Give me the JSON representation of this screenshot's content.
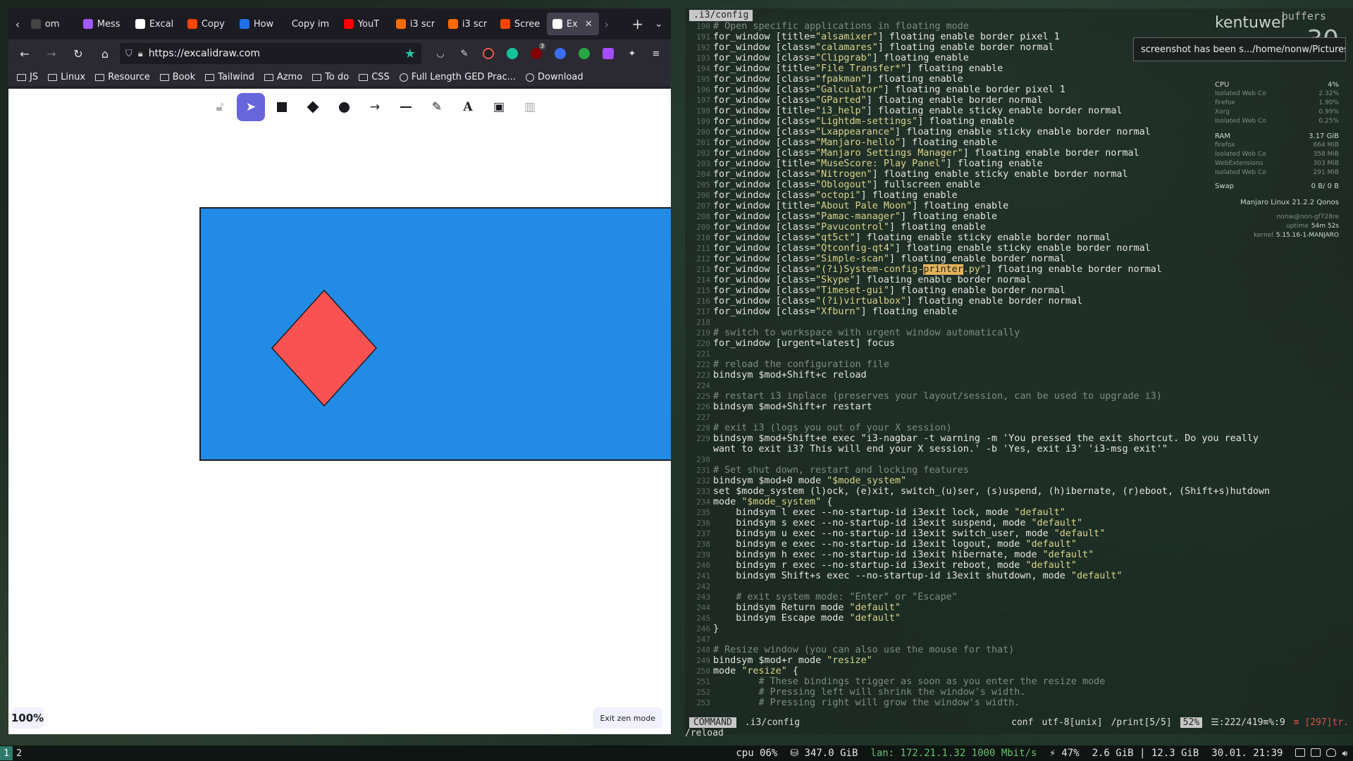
{
  "browser": {
    "tabs": [
      {
        "label": "om",
        "color": "#444"
      },
      {
        "label": "Mess",
        "color": "#a259ff"
      },
      {
        "label": "Excal",
        "color": "#ffffff"
      },
      {
        "label": "Copy",
        "color": "#ff4500"
      },
      {
        "label": "How",
        "color": "#1f6feb"
      },
      {
        "label": "Copy im",
        "color": ""
      },
      {
        "label": "YouT",
        "color": "#ff0000"
      },
      {
        "label": "i3 scr",
        "color": "#ff6a00"
      },
      {
        "label": "i3 scr",
        "color": "#ff6a00"
      },
      {
        "label": "Scree",
        "color": "#ff4500"
      },
      {
        "label": "Ex",
        "color": "#ffffff"
      }
    ],
    "url": "https://excalidraw.com",
    "bookmarks": [
      {
        "label": "JS",
        "icon": "folder"
      },
      {
        "label": "Linux",
        "icon": "folder"
      },
      {
        "label": "Resource",
        "icon": "folder"
      },
      {
        "label": "Book",
        "icon": "folder"
      },
      {
        "label": "Tailwind",
        "icon": "folder"
      },
      {
        "label": "Azmo",
        "icon": "folder"
      },
      {
        "label": "To do",
        "icon": "folder"
      },
      {
        "label": "CSS",
        "icon": "folder"
      },
      {
        "label": "Full Length GED Prac...",
        "icon": "globe"
      },
      {
        "label": "Download",
        "icon": "globe"
      }
    ],
    "extension_badge": "3"
  },
  "excalidraw": {
    "zoom": "100%",
    "exit_zen": "Exit zen mode",
    "colors": {
      "rect_fill": "#228be6",
      "diamond_fill": "#fa5252",
      "accent": "#6965db"
    }
  },
  "vim": {
    "title": ".i3/config",
    "buffers": "buffers",
    "lines": [
      {
        "n": "190",
        "t": "# Open specific applications in floating mode",
        "k": "com"
      },
      {
        "n": "191",
        "t": "for_window [title=\"alsamixer\"] floating enable border pixel 1"
      },
      {
        "n": "192",
        "t": "for_window [class=\"calamares\"] floating enable border normal"
      },
      {
        "n": "193",
        "t": "for_window [class=\"Clipgrab\"] floating enable"
      },
      {
        "n": "194",
        "t": "for_window [title=\"File Transfer*\"] floating enable"
      },
      {
        "n": "195",
        "t": "for_window [class=\"fpakman\"] floating enable"
      },
      {
        "n": "196",
        "t": "for_window [class=\"Galculator\"] floating enable border pixel 1"
      },
      {
        "n": "197",
        "t": "for_window [class=\"GParted\"] floating enable border normal"
      },
      {
        "n": "198",
        "t": "for_window [title=\"i3_help\"] floating enable sticky enable border normal"
      },
      {
        "n": "199",
        "t": "for_window [class=\"Lightdm-settings\"] floating enable"
      },
      {
        "n": "200",
        "t": "for_window [class=\"Lxappearance\"] floating enable sticky enable border normal"
      },
      {
        "n": "201",
        "t": "for_window [class=\"Manjaro-hello\"] floating enable"
      },
      {
        "n": "202",
        "t": "for_window [class=\"Manjaro Settings Manager\"] floating enable border normal"
      },
      {
        "n": "203",
        "t": "for_window [title=\"MuseScore: Play Panel\"] floating enable"
      },
      {
        "n": "204",
        "t": "for_window [class=\"Nitrogen\"] floating enable sticky enable border normal"
      },
      {
        "n": "205",
        "t": "for_window [class=\"Oblogout\"] fullscreen enable"
      },
      {
        "n": "206",
        "t": "for_window [class=\"octopi\"] floating enable"
      },
      {
        "n": "207",
        "t": "for_window [title=\"About Pale Moon\"] floating enable"
      },
      {
        "n": "208",
        "t": "for_window [class=\"Pamac-manager\"] floating enable"
      },
      {
        "n": "209",
        "t": "for_window [class=\"Pavucontrol\"] floating enable"
      },
      {
        "n": "210",
        "t": "for_window [class=\"qt5ct\"] floating enable sticky enable border normal"
      },
      {
        "n": "211",
        "t": "for_window [class=\"Qtconfig-qt4\"] floating enable sticky enable border normal"
      },
      {
        "n": "212",
        "t": "for_window [class=\"Simple-scan\"] floating enable border normal"
      },
      {
        "n": "213",
        "t": "for_window [class=\"(?i)System-config-printer.py\"] floating enable border normal"
      },
      {
        "n": "214",
        "t": "for_window [class=\"Skype\"] floating enable border normal"
      },
      {
        "n": "215",
        "t": "for_window [class=\"Timeset-gui\"] floating enable border normal"
      },
      {
        "n": "216",
        "t": "for_window [class=\"(?i)virtualbox\"] floating enable border normal"
      },
      {
        "n": "217",
        "t": "for_window [class=\"Xfburn\"] floating enable"
      },
      {
        "n": "218",
        "t": ""
      },
      {
        "n": "219",
        "t": "# switch to workspace with urgent window automatically",
        "k": "com"
      },
      {
        "n": "220",
        "t": "for_window [urgent=latest] focus"
      },
      {
        "n": "221",
        "t": ""
      },
      {
        "n": "222",
        "t": "# reload the configuration file",
        "k": "com"
      },
      {
        "n": "223",
        "t": "bindsym $mod+Shift+c reload"
      },
      {
        "n": "224",
        "t": ""
      },
      {
        "n": "225",
        "t": "# restart i3 inplace (preserves your layout/session, can be used to upgrade i3)",
        "k": "com"
      },
      {
        "n": "226",
        "t": "bindsym $mod+Shift+r restart"
      },
      {
        "n": "227",
        "t": ""
      },
      {
        "n": "228",
        "t": "# exit i3 (logs you out of your X session)",
        "k": "com"
      },
      {
        "n": "229",
        "t": "bindsym $mod+Shift+e exec \"i3-nagbar -t warning -m 'You pressed the exit shortcut. Do you really"
      },
      {
        "n": "",
        "t": "want to exit i3? This will end your X session.' -b 'Yes, exit i3' 'i3-msg exit'\""
      },
      {
        "n": "230",
        "t": ""
      },
      {
        "n": "231",
        "t": "# Set shut down, restart and locking features",
        "k": "com"
      },
      {
        "n": "232",
        "t": "bindsym $mod+0 mode \"$mode_system\""
      },
      {
        "n": "233",
        "t": "set $mode_system (l)ock, (e)xit, switch_(u)ser, (s)uspend, (h)ibernate, (r)eboot, (Shift+s)hutdown"
      },
      {
        "n": "234",
        "t": "mode \"$mode_system\" {"
      },
      {
        "n": "235",
        "t": "    bindsym l exec --no-startup-id i3exit lock, mode \"default\""
      },
      {
        "n": "236",
        "t": "    bindsym s exec --no-startup-id i3exit suspend, mode \"default\""
      },
      {
        "n": "237",
        "t": "    bindsym u exec --no-startup-id i3exit switch_user, mode \"default\""
      },
      {
        "n": "238",
        "t": "    bindsym e exec --no-startup-id i3exit logout, mode \"default\""
      },
      {
        "n": "239",
        "t": "    bindsym h exec --no-startup-id i3exit hibernate, mode \"default\""
      },
      {
        "n": "240",
        "t": "    bindsym r exec --no-startup-id i3exit reboot, mode \"default\""
      },
      {
        "n": "241",
        "t": "    bindsym Shift+s exec --no-startup-id i3exit shutdown, mode \"default\""
      },
      {
        "n": "242",
        "t": ""
      },
      {
        "n": "243",
        "t": "    # exit system mode: \"Enter\" or \"Escape\"",
        "k": "com"
      },
      {
        "n": "244",
        "t": "    bindsym Return mode \"default\""
      },
      {
        "n": "245",
        "t": "    bindsym Escape mode \"default\""
      },
      {
        "n": "246",
        "t": "}"
      },
      {
        "n": "247",
        "t": ""
      },
      {
        "n": "248",
        "t": "# Resize window (you can also use the mouse for that)",
        "k": "com"
      },
      {
        "n": "249",
        "t": "bindsym $mod+r mode \"resize\""
      },
      {
        "n": "250",
        "t": "mode \"resize\" {"
      },
      {
        "n": "251",
        "t": "        # These bindings trigger as soon as you enter the resize mode",
        "k": "com"
      },
      {
        "n": "252",
        "t": "        # Pressing left will shrink the window's width.",
        "k": "com"
      },
      {
        "n": "253",
        "t": "        # Pressing right will grow the window's width.",
        "k": "com"
      }
    ],
    "status": {
      "mode": "COMMAND",
      "file": ".i3/config",
      "filetype": "conf",
      "encoding": "utf-8[unix]",
      "search": "/print[5/5]",
      "percent": "52%",
      "position": "☰:222/419≡%:9",
      "error": "≡ [297]tr."
    },
    "cmdline": "/reload"
  },
  "conky": {
    "host": "kentuwei",
    "big": "30",
    "cpu_label": "CPU",
    "cpu_value": "4%",
    "cpu_procs": [
      {
        "name": "Isolated Web Co",
        "val": "2.32%"
      },
      {
        "name": "firefox",
        "val": "1.90%"
      },
      {
        "name": "Xorg",
        "val": "0.99%"
      },
      {
        "name": "Isolated Web Co",
        "val": "0.25%"
      }
    ],
    "ram_label": "RAM",
    "ram_value": "3.17 GiB",
    "ram_procs": [
      {
        "name": "firefox",
        "val": "664 MiB"
      },
      {
        "name": "Isolated Web Co",
        "val": "358 MiB"
      },
      {
        "name": "WebExtensions",
        "val": "303 MiB"
      },
      {
        "name": "Isolated Web Co",
        "val": "291 MiB"
      }
    ],
    "swap_label": "Swap",
    "swap_value": "0 B/ 0 B",
    "os": "Manjaro Linux 21.2.2 Qonos",
    "user": "nonw@non-gf728re",
    "uptime_label": "uptime",
    "uptime_value": "54m 52s",
    "kernel_label": "kernel",
    "kernel_value": "5.15.16-1-MANJARO"
  },
  "notification": "screenshot has been s.../home/nonw/Pictures",
  "bar": {
    "workspaces": [
      "1",
      "2"
    ],
    "cpu": "cpu  06%",
    "disk": "⛁ 347.0 GiB",
    "lan": "lan: 172.21.1.32 1000 Mbit/s",
    "battery": "⚡ 47%",
    "mem": "2.6 GiB | 12.3 GiB",
    "datetime": "30.01. 21:39"
  }
}
